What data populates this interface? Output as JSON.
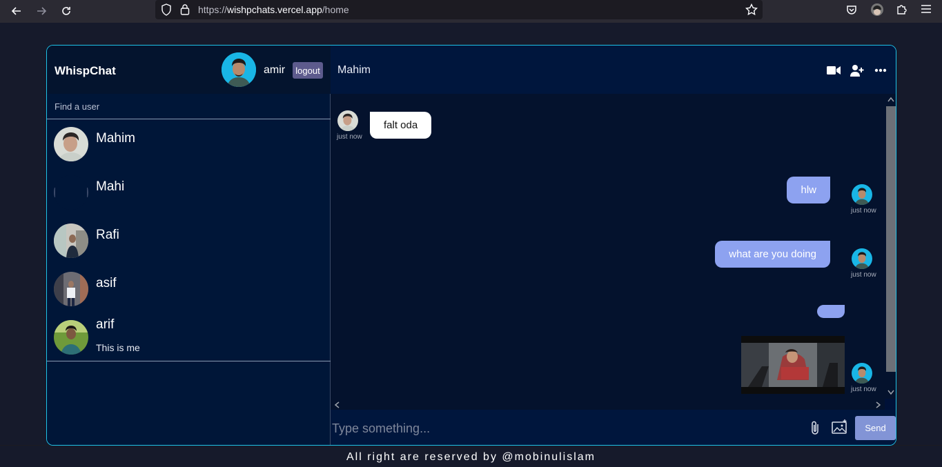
{
  "browser": {
    "url_scheme": "https://",
    "url_host": "wishpchats.vercel.app",
    "url_path": "/home"
  },
  "sidebar": {
    "brand": "WhispChat",
    "current_user": "amir",
    "logout_label": "logout",
    "search_placeholder": "Find a user",
    "users": [
      {
        "name": "Mahim",
        "status": ""
      },
      {
        "name": "Mahi",
        "status": ""
      },
      {
        "name": "Rafi",
        "status": ""
      },
      {
        "name": "asif",
        "status": ""
      },
      {
        "name": "arif",
        "status": "This is me"
      }
    ]
  },
  "chat": {
    "title": "Mahim",
    "header_icons": [
      "video-camera-icon",
      "add-user-icon",
      "more-options-icon"
    ],
    "messages": [
      {
        "direction": "incoming",
        "text": "falt oda",
        "time": "just now"
      },
      {
        "direction": "outgoing",
        "text": "hlw",
        "time": "just now"
      },
      {
        "direction": "outgoing",
        "text": "what are you doing",
        "time": "just now"
      },
      {
        "direction": "outgoing",
        "text": "",
        "time": ""
      },
      {
        "direction": "outgoing",
        "type": "image",
        "time": "just now"
      }
    ],
    "input_placeholder": "Type something...",
    "send_label": "Send"
  },
  "footer": {
    "text": "All right are reserved by @mobinulislam"
  },
  "colors": {
    "accent_border": "#1ec3e8",
    "outgoing_bubble": "#8da2f0",
    "send_button": "#8294d6",
    "logout_button": "#5d5b8d"
  }
}
